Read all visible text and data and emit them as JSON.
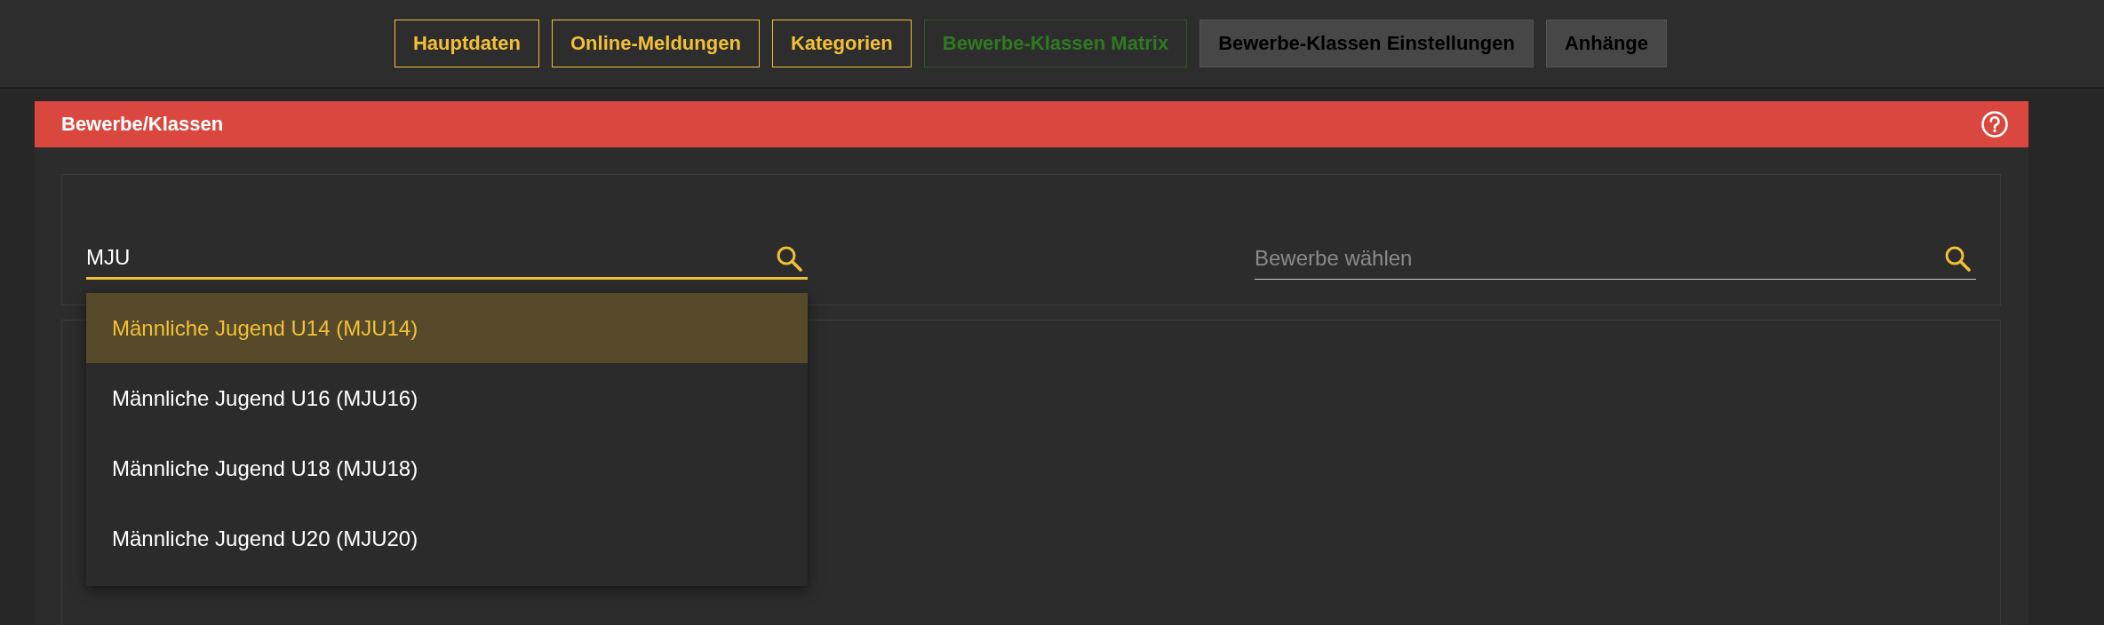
{
  "tabs": [
    {
      "label": "Hauptdaten",
      "selected": false,
      "disabled": false
    },
    {
      "label": "Online-Meldungen",
      "selected": false,
      "disabled": false
    },
    {
      "label": "Kategorien",
      "selected": false,
      "disabled": false
    },
    {
      "label": "Bewerbe-Klassen Matrix",
      "selected": true,
      "disabled": false
    },
    {
      "label": "Bewerbe-Klassen Einstellungen",
      "selected": false,
      "disabled": true
    },
    {
      "label": "Anhänge",
      "selected": false,
      "disabled": true
    }
  ],
  "panel": {
    "title": "Bewerbe/Klassen"
  },
  "search_fields": [
    {
      "value": "MJU",
      "focused": true
    },
    {
      "placeholder": "Bewerbe wählen",
      "focused": false
    }
  ],
  "dropdown": {
    "options": [
      {
        "label": "Männliche Jugend U14 (MJU14)",
        "selected": true
      },
      {
        "label": "Männliche Jugend U16 (MJU16)",
        "selected": false
      },
      {
        "label": "Männliche Jugend U18 (MJU18)",
        "selected": false
      },
      {
        "label": "Männliche Jugend U20 (MJU20)",
        "selected": false
      }
    ]
  }
}
